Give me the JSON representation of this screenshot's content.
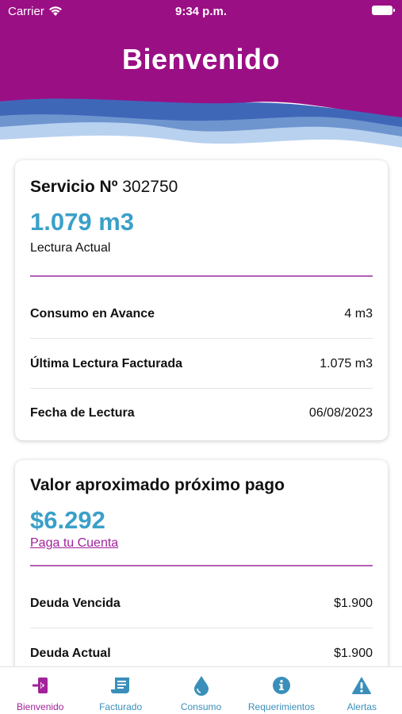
{
  "status_bar": {
    "carrier": "Carrier",
    "time": "9:34 p.m."
  },
  "header": {
    "title": "Bienvenido"
  },
  "service_card": {
    "label": "Servicio Nº",
    "number": "302750",
    "reading_value": "1.079 m3",
    "reading_label": "Lectura Actual",
    "rows": [
      {
        "label": "Consumo en Avance",
        "value": "4 m3"
      },
      {
        "label": "Última Lectura Facturada",
        "value": "1.075 m3"
      },
      {
        "label": "Fecha de Lectura",
        "value": "06/08/2023"
      }
    ]
  },
  "payment_card": {
    "title": "Valor aproximado próximo pago",
    "amount": "$6.292",
    "pay_link": "Paga tu Cuenta",
    "rows": [
      {
        "label": "Deuda Vencida",
        "value": "$1.900"
      },
      {
        "label": "Deuda Actual",
        "value": "$1.900"
      }
    ]
  },
  "tabbar": {
    "active": "Bienvenido",
    "tabs": [
      {
        "label": "Bienvenido",
        "icon": "sign-in-icon"
      },
      {
        "label": "Facturado",
        "icon": "receipt-icon"
      },
      {
        "label": "Consumo",
        "icon": "water-drop-icon"
      },
      {
        "label": "Requerimientos",
        "icon": "info-icon"
      },
      {
        "label": "Alertas",
        "icon": "warning-icon"
      }
    ]
  },
  "colors": {
    "header_purple": "#9b0f85",
    "accent_blue": "#3aa0c8",
    "link_purple": "#a1229a",
    "wave_dark": "#3f67b8",
    "wave_light": "#b8d1ef"
  }
}
